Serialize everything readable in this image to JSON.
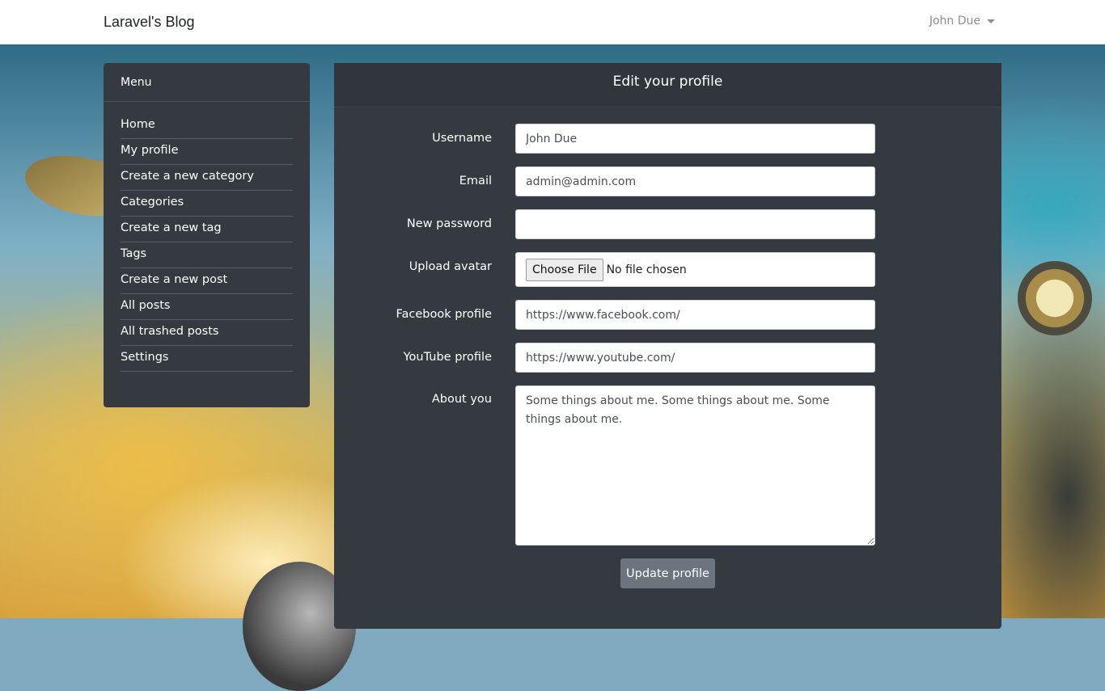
{
  "navbar": {
    "brand": "Laravel's Blog",
    "user_name": "John Due"
  },
  "menu": {
    "title": "Menu",
    "items": [
      {
        "label": "Home"
      },
      {
        "label": "My profile"
      },
      {
        "label": "Create a new category"
      },
      {
        "label": "Categories"
      },
      {
        "label": "Create a new tag"
      },
      {
        "label": "Tags"
      },
      {
        "label": "Create a new post"
      },
      {
        "label": "All posts"
      },
      {
        "label": "All trashed posts"
      },
      {
        "label": "Settings"
      }
    ]
  },
  "profile_form": {
    "title": "Edit your profile",
    "username": {
      "label": "Username",
      "value": "John Due"
    },
    "email": {
      "label": "Email",
      "value": "admin@admin.com"
    },
    "new_password": {
      "label": "New password",
      "value": ""
    },
    "avatar": {
      "label": "Upload avatar",
      "button": "Choose File",
      "status": "No file chosen"
    },
    "facebook": {
      "label": "Facebook profile",
      "value": "https://www.facebook.com/"
    },
    "youtube": {
      "label": "YouTube profile",
      "value": "https://www.youtube.com/"
    },
    "about": {
      "label": "About you",
      "value": "Some things about me. Some things about me. Some things about me."
    },
    "submit_label": "Update profile"
  },
  "colors": {
    "card_bg": "#343a40",
    "button_secondary": "#6c757d",
    "navbar_bg": "#ffffff"
  }
}
